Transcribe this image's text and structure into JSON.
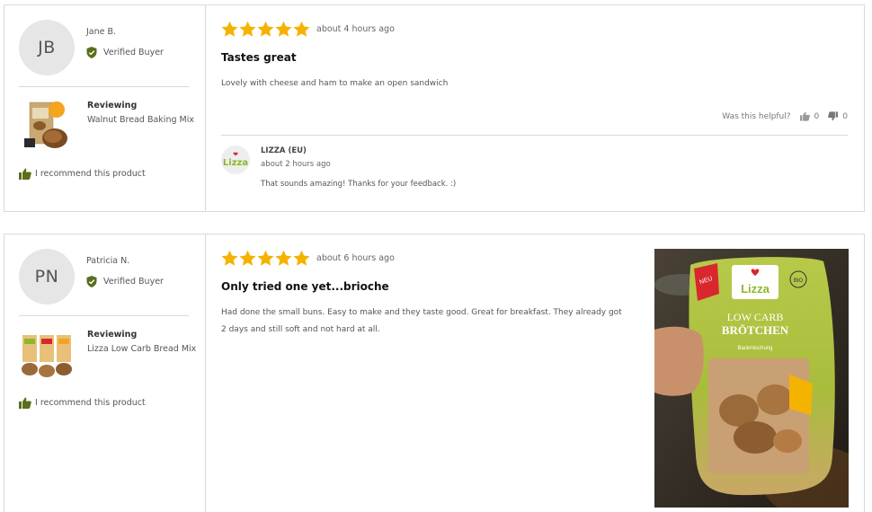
{
  "colors": {
    "star": "#f5b301",
    "verified": "#5a6e1c",
    "brand_green": "#8cb82a",
    "brand_red": "#d9272e"
  },
  "reviews": [
    {
      "initials": "JB",
      "author": "Jane B.",
      "verified_label": "Verified Buyer",
      "reviewing_label": "Reviewing",
      "product": "Walnut Bread Baking Mix",
      "recommend": "I recommend this product",
      "rating": 5,
      "time": "about 4 hours ago",
      "title": "Tastes great",
      "body": "Lovely with cheese and ham to make an open sandwich",
      "helpful_label": "Was this helpful?",
      "up_votes": "0",
      "down_votes": "0",
      "reply": {
        "logo_text": "Lizza",
        "name": "LIZZA (EU)",
        "time": "about 2 hours ago",
        "text": "That sounds amazing! Thanks for your feedback. :)"
      }
    },
    {
      "initials": "PN",
      "author": "Patricia N.",
      "verified_label": "Verified Buyer",
      "reviewing_label": "Reviewing",
      "product": "Lizza Low Carb Bread Mix",
      "recommend": "I recommend this product",
      "rating": 5,
      "time": "about 6 hours ago",
      "title": "Only tried one yet...brioche",
      "body": "Had done the small buns. Easy to make and they taste good. Great for breakfast. They already got 2 days and still soft and not hard at all.",
      "photo": {
        "badge": "NEU",
        "brand": "Lizza",
        "organic": "BIO",
        "product_line1": "LOW CARB",
        "product_line2": "BRÖTCHEN",
        "subtitle": "Backmischung"
      }
    }
  ]
}
